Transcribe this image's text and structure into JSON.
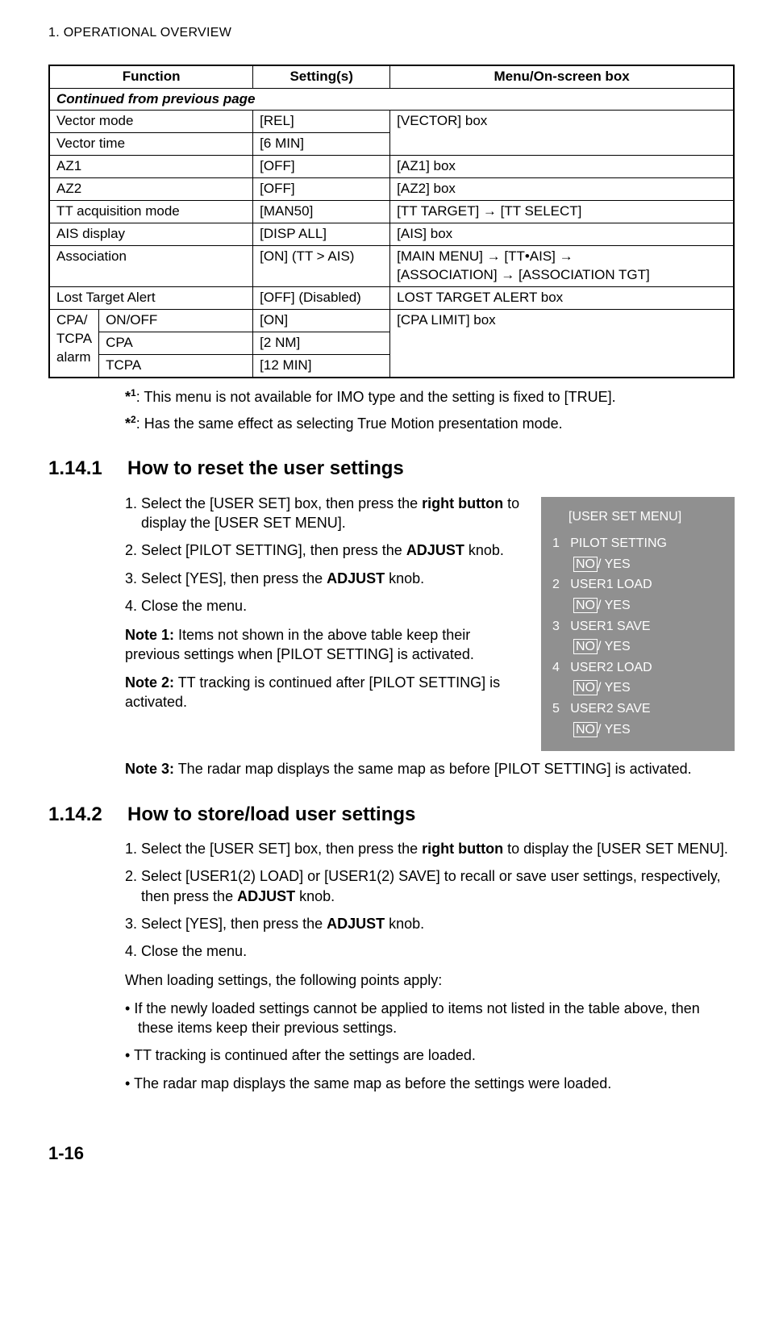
{
  "header": "1.  OPERATIONAL OVERVIEW",
  "pageNumber": "1-16",
  "table": {
    "headers": {
      "c1": "Function",
      "c2": "Setting(s)",
      "c3": "Menu/On-screen box"
    },
    "continued": "Continued from previous page",
    "rows": {
      "vectorMode": {
        "f": "Vector mode",
        "s": "[REL]",
        "m": "[VECTOR] box"
      },
      "vectorTime": {
        "f": "Vector time",
        "s": "[6 MIN]"
      },
      "az1": {
        "f": "AZ1",
        "s": "[OFF]",
        "m": "[AZ1] box"
      },
      "az2": {
        "f": "AZ2",
        "s": "[OFF]",
        "m": "[AZ2] box"
      },
      "ttAcq": {
        "f": "TT acquisition mode",
        "s": "[MAN50]",
        "m": "[TT TARGET] → [TT SELECT]"
      },
      "aisDisp": {
        "f": "AIS display",
        "s": "[DISP ALL]",
        "m": "[AIS] box"
      },
      "assoc": {
        "f": "Association",
        "s": "[ON] (TT > AIS)",
        "m1": "[MAIN MENU] → [TT•AIS] →",
        "m2": "[ASSOCIATION] → [ASSOCIATION TGT]"
      },
      "lostTarget": {
        "f": "Lost Target Alert",
        "s": "[OFF] (Disabled)",
        "m": "LOST TARGET ALERT box"
      },
      "cpaGroup": "CPA/\nTCPA alarm",
      "cpaOnOff": {
        "f": "ON/OFF",
        "s": "[ON]",
        "m": "[CPA LIMIT] box"
      },
      "cpa": {
        "f": "CPA",
        "s": "[2 NM]"
      },
      "tcpa": {
        "f": "TCPA",
        "s": "[12 MIN]"
      }
    }
  },
  "footnotes": {
    "f1": {
      "marker": "*1",
      "text": ": This menu is not available for IMO type and the setting is fixed to [TRUE]."
    },
    "f2": {
      "marker": "*2",
      "text": ": Has the same effect as selecting True Motion presentation mode."
    }
  },
  "sec1": {
    "num": "1.14.1",
    "title": "How to reset the user settings",
    "steps": {
      "s1a": "Select the [USER SET] box, then press the ",
      "s1b": "right button",
      "s1c": " to display the [USER SET MENU].",
      "s2a": "Select [PILOT SETTING], then press the ",
      "s2b": "ADJUST",
      "s2c": " knob.",
      "s3a": "Select [YES], then press the ",
      "s3b": "ADJUST",
      "s3c": " knob.",
      "s4": "Close the menu."
    },
    "note1": {
      "label": "Note 1:",
      "text": " Items not shown in the above table keep their previous settings when [PILOT SETTING] is activated."
    },
    "note2": {
      "label": "Note 2:",
      "text": " TT tracking is continued after [PILOT SETTING] is activated."
    },
    "note3": {
      "label": "Note 3:",
      "text": " The radar map displays the same map as before [PILOT SETTING] is activated."
    }
  },
  "menuBox": {
    "title": "[USER SET MENU]",
    "items": {
      "i1": {
        "n": "1",
        "label": "PILOT SETTING"
      },
      "i2": {
        "n": "2",
        "label": "USER1 LOAD"
      },
      "i3": {
        "n": "3",
        "label": "USER1 SAVE"
      },
      "i4": {
        "n": "4",
        "label": "USER2 LOAD"
      },
      "i5": {
        "n": "5",
        "label": "USER2 SAVE"
      }
    },
    "optNo": "NO",
    "optYes": "/ YES"
  },
  "sec2": {
    "num": "1.14.2",
    "title": "How to store/load user settings",
    "steps": {
      "s1a": "Select the [USER SET] box, then press the ",
      "s1b": "right button",
      "s1c": " to display the [USER SET MENU].",
      "s2a": "Select [USER1(2) LOAD] or [USER1(2) SAVE] to recall or save user settings, respectively, then press the ",
      "s2b": "ADJUST",
      "s2c": " knob.",
      "s3a": "Select [YES], then press the ",
      "s3b": "ADJUST",
      "s3c": " knob.",
      "s4": "Close the menu."
    },
    "afterSteps": "When loading settings, the following points apply:",
    "bullets": {
      "b1": "If the newly loaded settings cannot be applied to items not listed in the table above, then these items keep their previous settings.",
      "b2": "TT tracking is continued after the settings are loaded.",
      "b3": "The radar map displays the same map as before the settings were loaded."
    }
  }
}
